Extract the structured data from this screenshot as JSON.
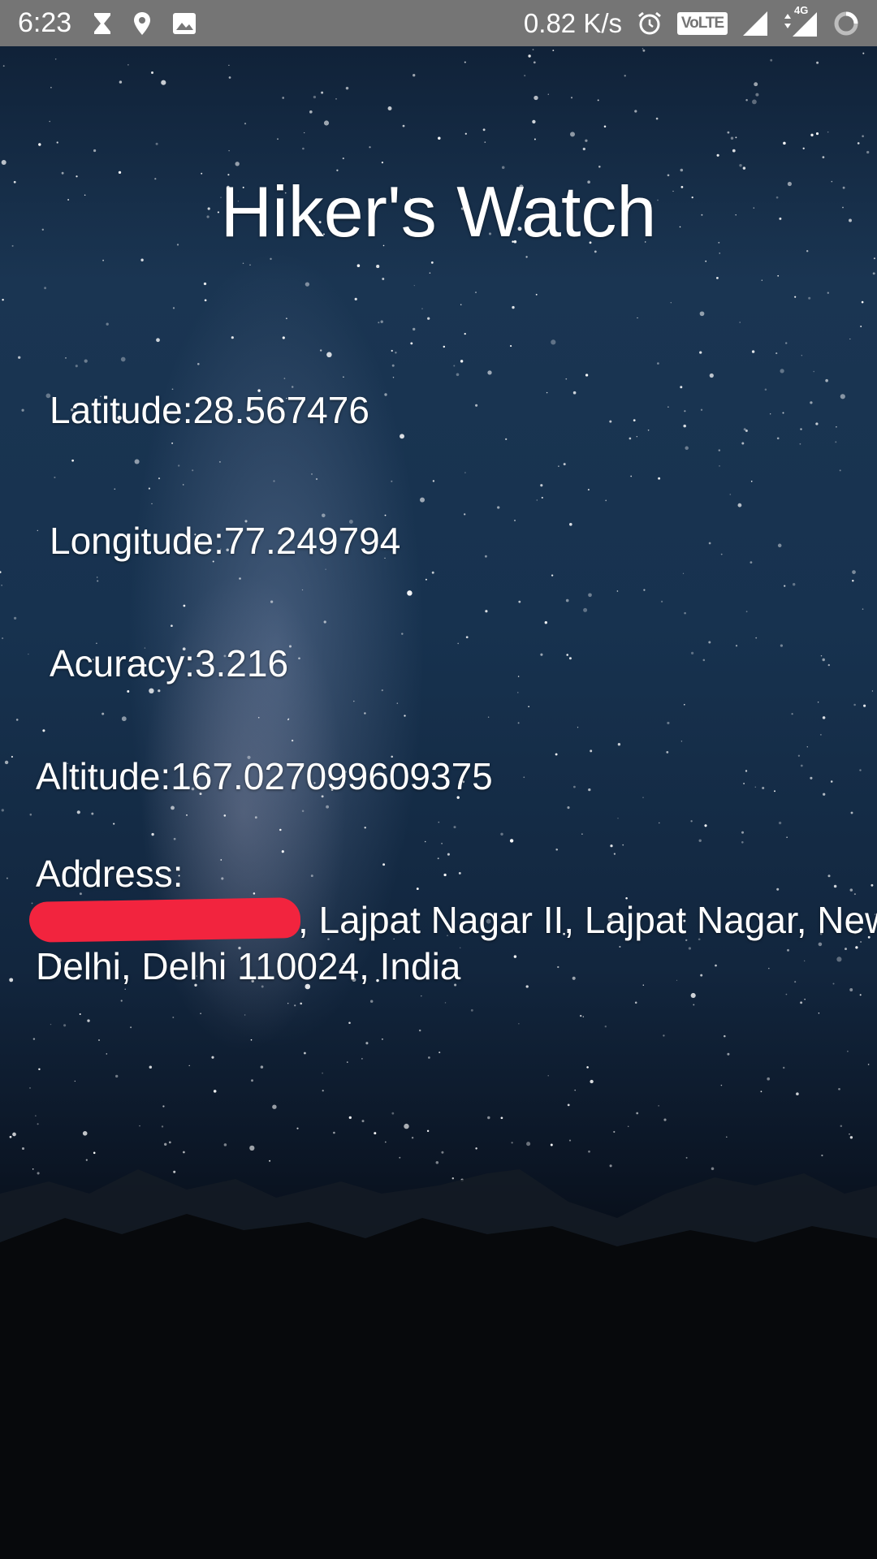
{
  "status_bar": {
    "time": "6:23",
    "left_icons": [
      "hourglass-icon",
      "location-pin-icon",
      "image-icon"
    ],
    "network_speed": "0.82 K/s",
    "volte_label": "VoLTE",
    "network_type": "4G",
    "right_icons": [
      "alarm-icon",
      "volte-icon",
      "signal-icon",
      "data-signal-icon",
      "battery-icon"
    ],
    "bar_color": "#757575"
  },
  "app": {
    "title": "Hiker's Watch",
    "latitude": "Latitude:28.567476",
    "longitude": "Longitude:77.249794",
    "accuracy": "Acuracy:3.216",
    "altitude": "Altitude:167.027099609375",
    "address_label": "Address:",
    "address_value": ", Lajpat Nagar II, Lajpat Nagar, New Delhi, Delhi 110024, India",
    "redaction_color": "#f2243e",
    "text_color": "#ffffff"
  }
}
